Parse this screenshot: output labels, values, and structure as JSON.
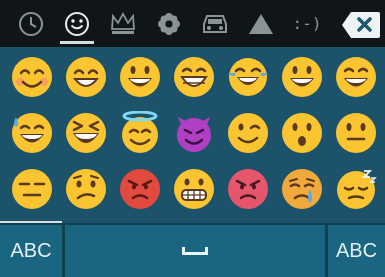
{
  "topbar": {
    "tabs": [
      {
        "icon": "recent-clock-icon",
        "active": false
      },
      {
        "icon": "smiley-face-icon",
        "active": true
      },
      {
        "icon": "crown-icon",
        "active": false
      },
      {
        "icon": "flower-icon",
        "active": false
      },
      {
        "icon": "car-icon",
        "active": false
      },
      {
        "icon": "triangle-symbol-icon",
        "active": false
      },
      {
        "icon": "emoticon-text-icon",
        "active": false,
        "label": ":-)"
      }
    ],
    "delete_icon": "backspace-delete-icon"
  },
  "emojis": [
    [
      "smiling-face-with-smiling-eyes",
      "grinning-face-with-smiling-eyes",
      "smiling-face-open-mouth",
      "grinning-face",
      "face-with-tears-of-joy",
      "smiling-face-open-mouth-2",
      "smiling-face-open-mouth-smiling-eyes"
    ],
    [
      "smiling-face-with-sweat",
      "laughing-squinting-face",
      "smiling-face-with-halo",
      "smiling-devil-face",
      "winking-face",
      "hushed-face",
      "neutral-face"
    ],
    [
      "expressionless-face",
      "confused-face",
      "pouting-face",
      "grimacing-face",
      "angry-face",
      "crying-face",
      "sleepy-face"
    ]
  ],
  "bottom": {
    "abc_left": "ABC",
    "space_icon": "space-bar-icon",
    "abc_right": "ABC"
  },
  "colors": {
    "topbar_bg": "#0f1518",
    "keyboard_bg": "#1c536a",
    "key_bg": "#1a6580",
    "emoji_yellow": "#fbc531",
    "devil_purple": "#b13fc4",
    "angry_red": "#e24a3f"
  }
}
